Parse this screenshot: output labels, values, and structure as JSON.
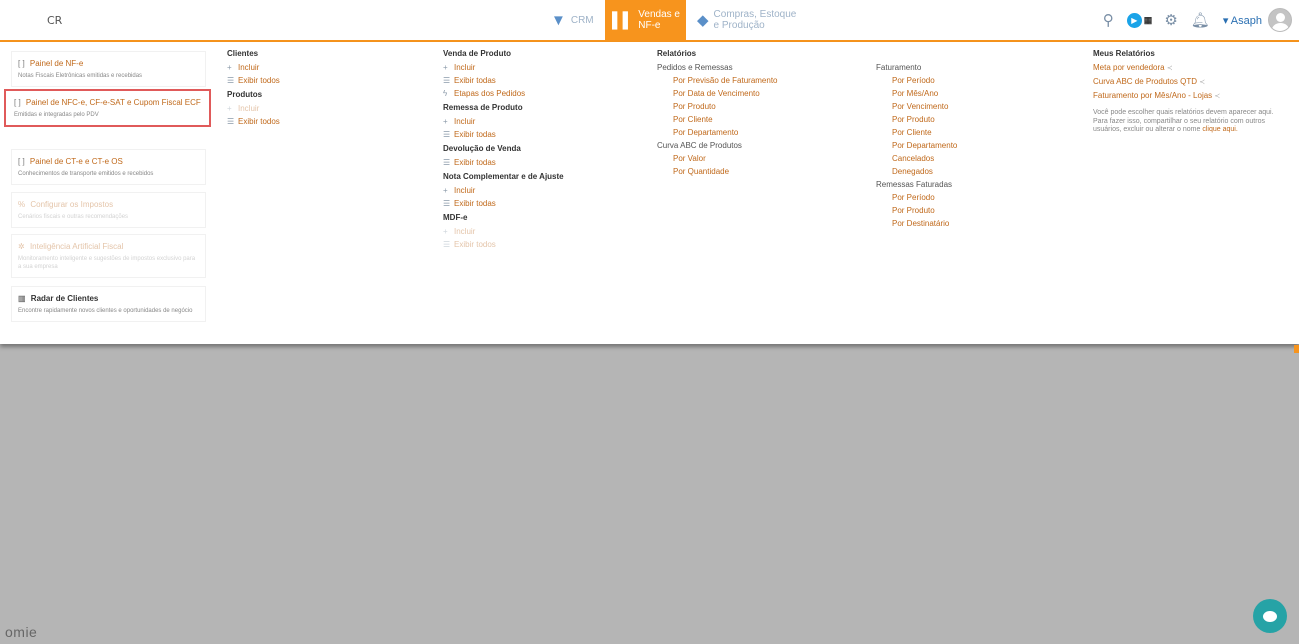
{
  "header": {
    "logo_glyph": "CR",
    "modules": [
      {
        "label_line1": "CRM",
        "label_line2": "",
        "icon": "funnel-icon",
        "glyph": "▼"
      },
      {
        "label_line1": "Vendas e",
        "label_line2": "NF-e",
        "icon": "chart-bars-icon",
        "glyph": "▌▌",
        "active": true
      },
      {
        "label_line1": "Compras, Estoque",
        "label_line2": "e Produção",
        "icon": "box-icon",
        "glyph": "◆"
      }
    ],
    "user_name": "Asaph",
    "accent_color": "#f7941d"
  },
  "cards": [
    {
      "title": "Painel de NF-e",
      "subtitle": "Notas Fiscais Eletrônicas emitidas e recebidas",
      "icon_glyph": "[ ]"
    },
    {
      "title": "Painel de NFC-e, CF-e-SAT e Cupom Fiscal ECF",
      "subtitle": "Emitidas e integradas pelo PDV",
      "icon_glyph": "[ ]"
    },
    {
      "title": "Painel de CT-e e CT-e OS",
      "subtitle": "Conhecimentos de transporte emitidos e recebidos",
      "icon_glyph": "[ ]"
    },
    {
      "title": "Configurar os Impostos",
      "subtitle": "Cenários fiscais e outras recomendações",
      "icon_glyph": "%"
    },
    {
      "title": "Inteligência Artificial Fiscal",
      "subtitle": "Monitoramento inteligente e sugestões de impostos exclusivo para a sua empresa",
      "icon_glyph": "✲"
    },
    {
      "title": "Radar de Clientes",
      "subtitle": "Encontre rapidamente novos clientes e oportunidades de negócio",
      "icon_glyph": "▥"
    }
  ],
  "col_cadastros": {
    "clientes": {
      "title": "Clientes",
      "incluir": "Incluir",
      "exibir": "Exibir todos"
    },
    "produtos": {
      "title": "Produtos",
      "incluir": "Incluir",
      "exibir": "Exibir todos"
    }
  },
  "col_vendas": {
    "venda": {
      "title": "Venda de Produto",
      "incluir": "Incluir",
      "exibir": "Exibir todas",
      "etapas": "Etapas dos Pedidos"
    },
    "remessa": {
      "title": "Remessa de Produto",
      "incluir": "Incluir",
      "exibir": "Exibir todas"
    },
    "devolucao": {
      "title": "Devolução de Venda",
      "exibir": "Exibir todas"
    },
    "complementar": {
      "title": "Nota Complementar e de Ajuste",
      "incluir": "Incluir",
      "exibir": "Exibir todas"
    },
    "mdfe": {
      "title": "MDF-e",
      "incluir": "Incluir",
      "exibir": "Exibir todos"
    }
  },
  "col_relatorios": {
    "title": "Relatórios",
    "pedidos_title": "Pedidos e Remessas",
    "pedidos_items": [
      "Por Previsão de Faturamento",
      "Por Data de Vencimento",
      "Por Produto",
      "Por Cliente",
      "Por Departamento"
    ],
    "abc_title": "Curva ABC de Produtos",
    "abc_items": [
      "Por Valor",
      "Por Quantidade"
    ]
  },
  "col_faturamento": {
    "fat_title": "Faturamento",
    "fat_items": [
      "Por Período",
      "Por Mês/Ano",
      "Por Vencimento",
      "Por Produto",
      "Por Cliente",
      "Por Departamento",
      "Cancelados",
      "Denegados"
    ],
    "rem_title": "Remessas Faturadas",
    "rem_items": [
      "Por Período",
      "Por Produto",
      "Por Destinatário"
    ]
  },
  "col_meus": {
    "title": "Meus Relatórios",
    "items": [
      "Meta por vendedora",
      "Curva ABC de Produtos QTD",
      "Faturamento por Mês/Ano - Lojas"
    ],
    "text1": "Você pode escolher quais relatórios devem aparecer aqui.",
    "text2": "Para fazer isso, compartilhar o seu relatório com outros usuários, excluir ou alterar o nome",
    "link": "clique aqui."
  },
  "footer": {
    "brand": "omie"
  }
}
